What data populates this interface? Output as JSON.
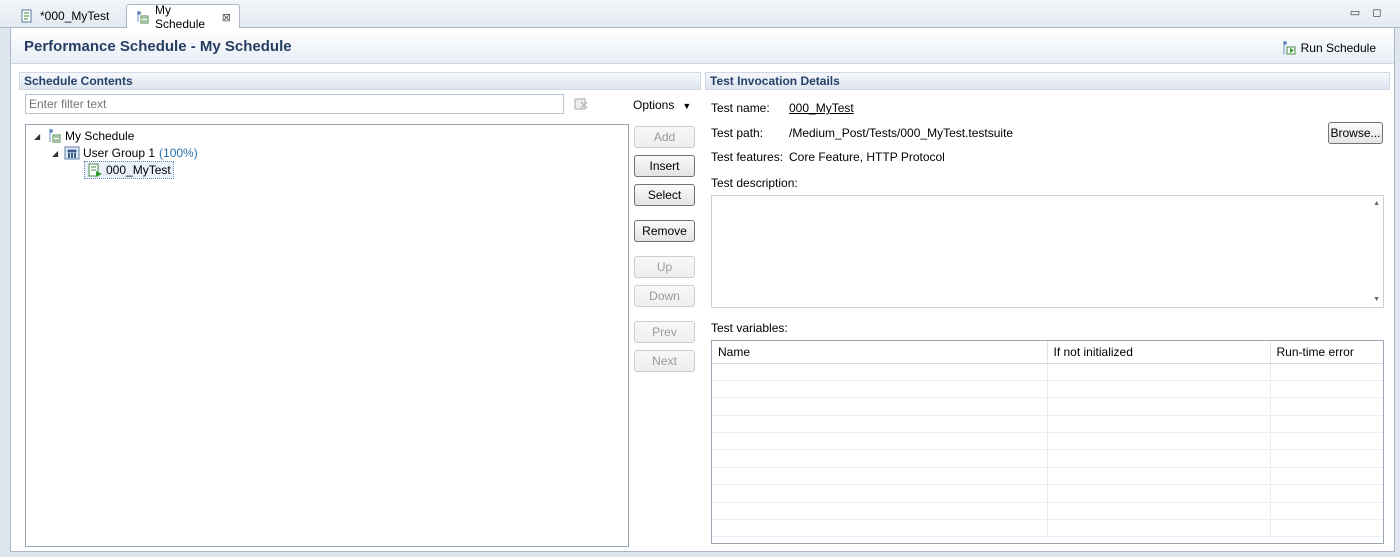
{
  "tabs": [
    {
      "label": "*000_MyTest",
      "icon": "test-script-icon"
    },
    {
      "label": "My Schedule",
      "icon": "schedule-icon",
      "close": "⊠"
    }
  ],
  "window_controls": {
    "minimize": "▭",
    "maximize": "◻"
  },
  "header": {
    "title": "Performance Schedule - My Schedule",
    "run_label": "Run Schedule"
  },
  "left": {
    "section_title": "Schedule Contents",
    "filter_placeholder": "Enter filter text",
    "options_label": "Options",
    "tree": {
      "root": "My Schedule",
      "group": "User Group 1",
      "group_pct": "(100%)",
      "test": "000_MyTest"
    },
    "buttons": {
      "add": "Add",
      "insert": "Insert",
      "select": "Select",
      "remove": "Remove",
      "up": "Up",
      "down": "Down",
      "prev": "Prev",
      "next": "Next"
    }
  },
  "right": {
    "section_title": "Test Invocation Details",
    "test_name_label": "Test name:",
    "test_name_value": "000_MyTest",
    "test_path_label": "Test path:",
    "test_path_value": "/Medium_Post/Tests/000_MyTest.testsuite",
    "browse_label": "Browse...",
    "test_features_label": "Test features:",
    "test_features_value": "Core Feature, HTTP Protocol",
    "description_label": "Test description:",
    "description_value": "",
    "variables_label": "Test variables:",
    "variables_columns": [
      "Name",
      "If not initialized",
      "Run-time error"
    ],
    "variables_rows": []
  }
}
